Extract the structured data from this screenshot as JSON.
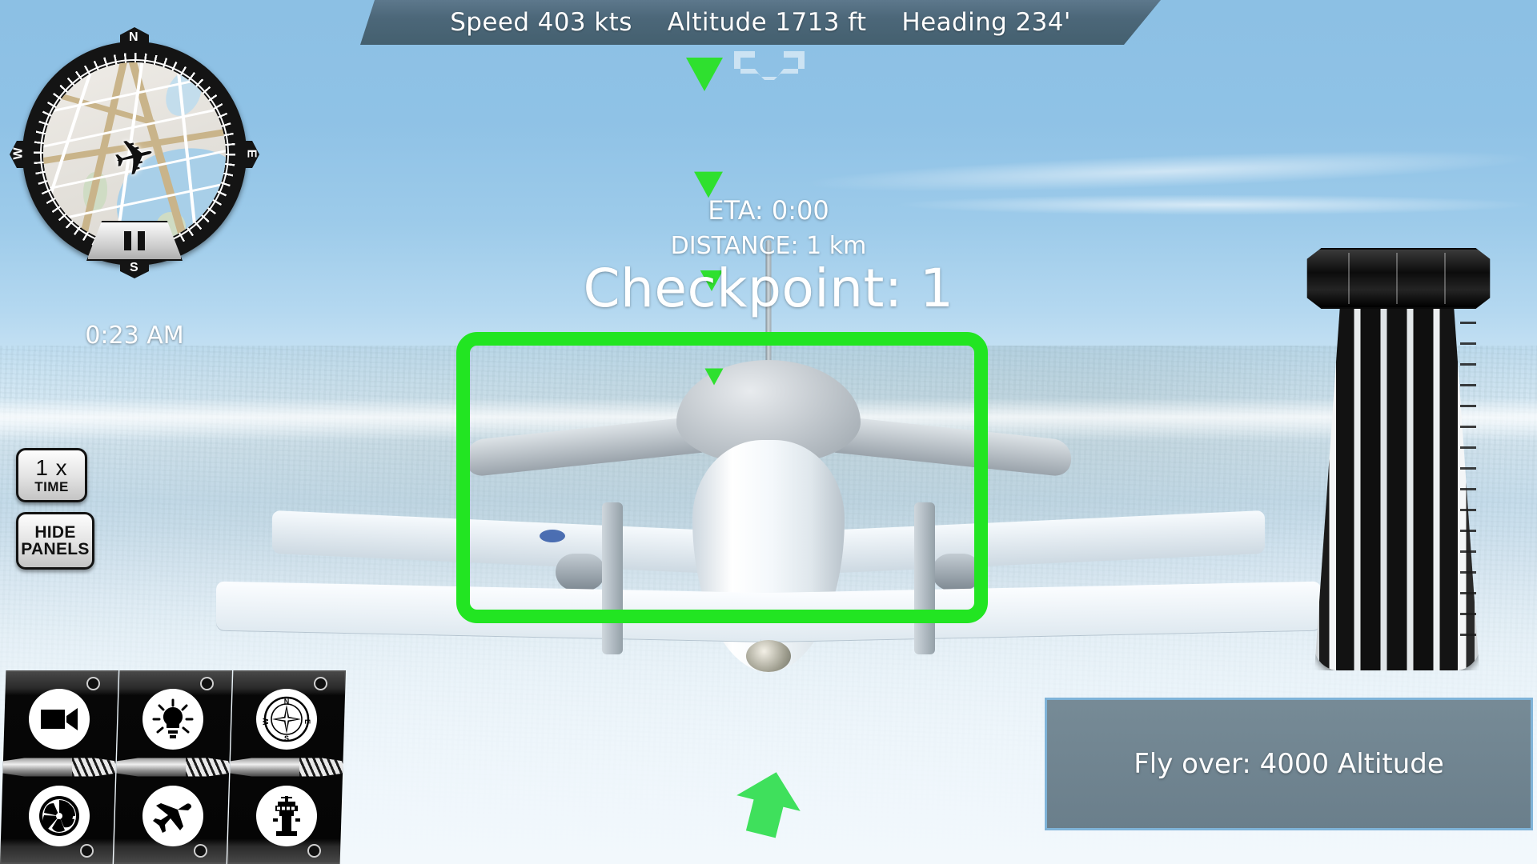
{
  "hud": {
    "speed": "Speed 403 kts",
    "altitude": "Altitude 1713 ft",
    "heading": "Heading 234'"
  },
  "minimap": {
    "cardinals": {
      "n": "N",
      "e": "E",
      "s": "S",
      "w": "W"
    },
    "plane_marker_icon": "airplane-marker-icon",
    "pause_button_label": "II",
    "clock": "0:23 AM"
  },
  "left_buttons": {
    "time": {
      "line1": "1 x",
      "line2": "TIME"
    },
    "hide_panels": {
      "line1": "HIDE",
      "line2": "PANELS"
    }
  },
  "objective": {
    "eta": "ETA: 0:00",
    "distance": "DISTANCE: 1 km",
    "checkpoint": "Checkpoint: 1",
    "gate_color": "#22e522",
    "marker_color": "#2fe02f"
  },
  "message_panel": {
    "text": "Fly over: 4000 Altitude",
    "border_color": "#7fb3d8",
    "fill_color": "#708591"
  },
  "throttle": {
    "name": "throttle-lever"
  },
  "icon_panel": {
    "columns": [
      {
        "top": {
          "icon": "camera-icon"
        },
        "bottom": {
          "icon": "turbine-icon"
        }
      },
      {
        "top": {
          "icon": "lightbulb-icon"
        },
        "bottom": {
          "icon": "airplane-icon"
        }
      },
      {
        "top": {
          "icon": "compass-rose-icon"
        },
        "bottom": {
          "icon": "control-tower-icon"
        }
      }
    ]
  },
  "theme": {
    "hud_bar": "#4c6779",
    "sky_top": "#8cc0e4",
    "accent_green": "#22e522"
  }
}
